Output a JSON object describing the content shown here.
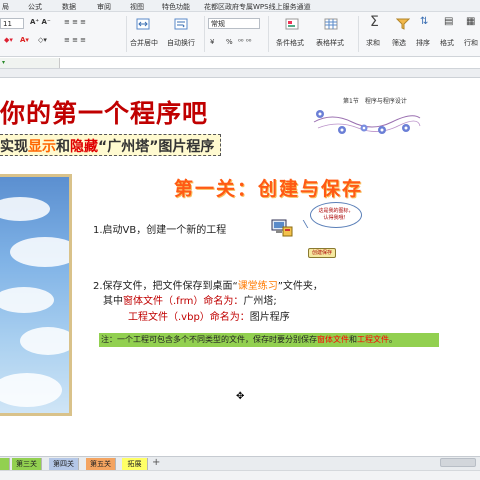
{
  "menu": {
    "tabs": [
      "局",
      "公式",
      "数据",
      "审阅",
      "视图",
      "特色功能",
      "花都区政府专属WPS线上服务通道"
    ]
  },
  "ribbon": {
    "font_size": "11",
    "format_select": "常规",
    "merge_center": "合并居中",
    "auto_wrap": "自动换行",
    "currency_symbol": "¥",
    "percent_symbol": "%",
    "conditional_format": "条件格式",
    "table_style": "表格样式",
    "sum": "求和",
    "filter": "筛选",
    "sort": "排序",
    "format": "格式",
    "row_col": "行和"
  },
  "slide": {
    "title": "你的第一个程序吧",
    "subtitle_pre": "实现",
    "subtitle_show": "显示",
    "subtitle_and": "和",
    "subtitle_hide": "隐藏",
    "subtitle_post": "“广州塔”图片程序",
    "chapter": "第1节　程序与程序设计",
    "level_title": "第一关：创建与保存",
    "step1": "1.启动VB，创建一个新的工程",
    "step2_pre": "2.保存文件，把文件保存到桌面“",
    "step2_folder": "课堂练习",
    "step2_post": "”文件夹，",
    "step3_pre": "其中",
    "step3_form": "窗体文件（.frm）命名为：",
    "step3_form_name": "广州塔;",
    "step4_proj": "工程文件（.vbp）命名为：",
    "step4_proj_name": "图片程序",
    "note_pre": "注：一个工程可包含多个不同类型的文件，保存时要分别保存",
    "note_form": "窗体文件",
    "note_and": "和",
    "note_proj": "工程文件",
    "note_end": "。",
    "bubble_text": "这是我的图标，\n认得我哦！",
    "button_label": "创建保存"
  },
  "sheet_tabs": [
    "第三关",
    "第四关",
    "第五关",
    "拓展"
  ],
  "colors": {
    "title_red": "#c00000",
    "level_orange": "#ff5a14",
    "note_green": "#92d050",
    "tab_green": "#92d050",
    "tab_orange": "#f4a460"
  }
}
